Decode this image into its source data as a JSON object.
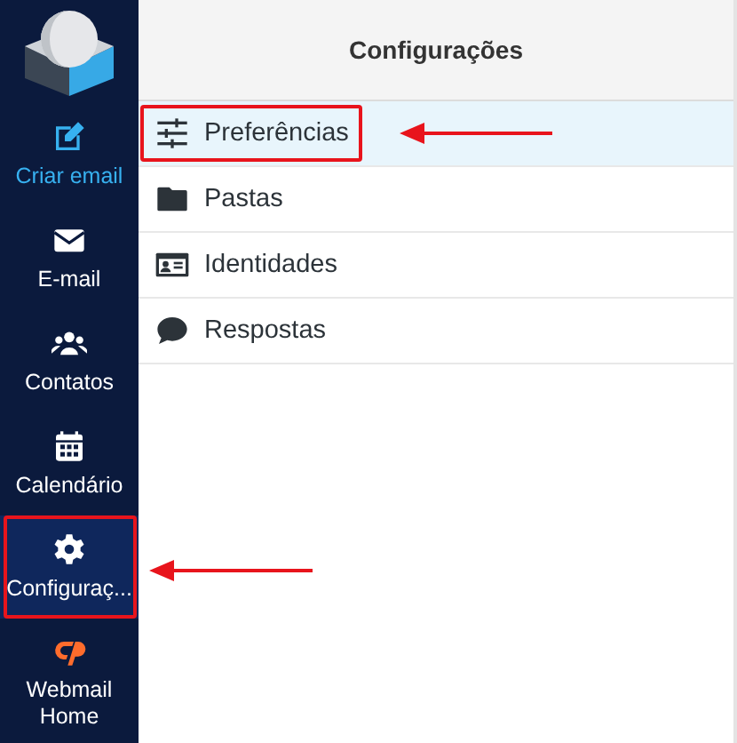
{
  "sidebar": {
    "items": [
      {
        "label": "Criar email",
        "kind": "action",
        "selected": false,
        "highlighted": false
      },
      {
        "label": "E-mail",
        "kind": "link",
        "selected": false,
        "highlighted": false
      },
      {
        "label": "Contatos",
        "kind": "link",
        "selected": false,
        "highlighted": false
      },
      {
        "label": "Calendário",
        "kind": "link",
        "selected": false,
        "highlighted": false
      },
      {
        "label": "Configuraç...",
        "kind": "link",
        "selected": true,
        "highlighted": true
      },
      {
        "label": "Webmail Home",
        "kind": "brand",
        "selected": false,
        "highlighted": false
      }
    ]
  },
  "settings": {
    "title": "Configurações",
    "items": [
      {
        "label": "Preferências",
        "selected": true,
        "highlighted": true
      },
      {
        "label": "Pastas",
        "selected": false,
        "highlighted": false
      },
      {
        "label": "Identidades",
        "selected": false,
        "highlighted": false
      },
      {
        "label": "Respostas",
        "selected": false,
        "highlighted": false
      }
    ]
  }
}
